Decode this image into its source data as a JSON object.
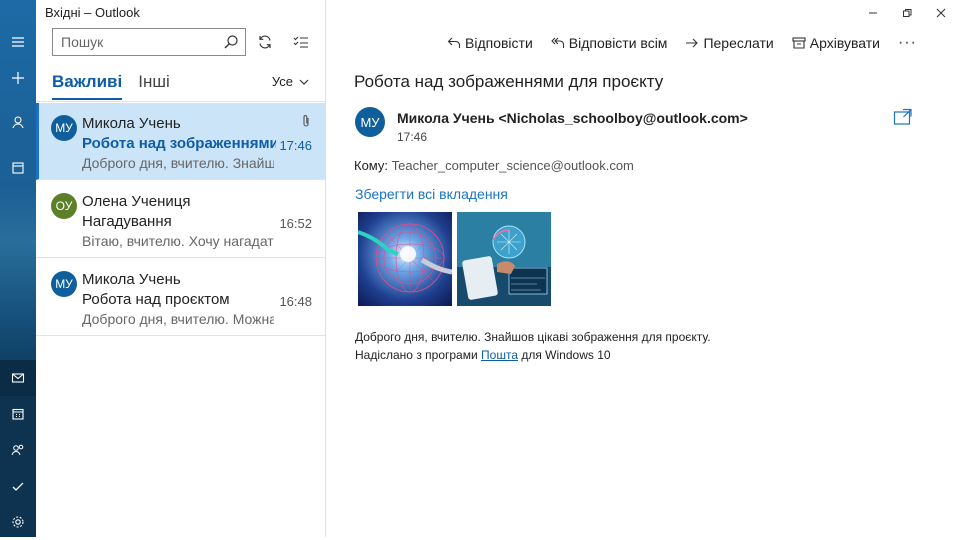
{
  "window": {
    "title": "Вхідні – Outlook"
  },
  "search": {
    "placeholder": "Пошук"
  },
  "tabs": [
    {
      "label": "Важливі"
    },
    {
      "label": "Інші"
    }
  ],
  "filter": {
    "label": "Усе"
  },
  "messages": [
    {
      "avatar_initials": "МУ",
      "avatar_color": "#0f5f9c",
      "from": "Микола Учень",
      "subject": "Робота над зображеннями для проєкту",
      "preview": "Доброго дня, вчителю. Знайшов цікаві зображення для проєкту.",
      "time": "17:46",
      "has_attachment": true,
      "selected": true
    },
    {
      "avatar_initials": "ОУ",
      "avatar_color": "#5c7f28",
      "from": "Олена Учениця",
      "subject": "Нагадування",
      "preview": "Вітаю, вчителю. Хочу нагадати",
      "time": "16:52",
      "has_attachment": false,
      "selected": false
    },
    {
      "avatar_initials": "МУ",
      "avatar_color": "#0f5f9c",
      "from": "Микола Учень",
      "subject": "Робота над проєктом",
      "preview": "Доброго дня, вчителю. Можна",
      "time": "16:48",
      "has_attachment": false,
      "selected": false
    }
  ],
  "toolbar": {
    "reply": "Відповісти",
    "reply_all": "Відповісти всім",
    "forward": "Переслати",
    "archive": "Архівувати",
    "more": "···"
  },
  "reading": {
    "subject": "Робота над зображеннями для проєкту",
    "sender_initials": "МУ",
    "sender": "Микола Учень <Nicholas_schoolboy@outlook.com>",
    "time": "17:46",
    "to_label": "Кому:",
    "to": "Teacher_computer_science@outlook.com",
    "save_all": "Зберегти всі вкладення",
    "body_line1": "Доброго дня, вчителю. Знайшов цікаві зображення для проєкту.",
    "body_line2_prefix": "Надіслано з програми",
    "body_link": "Пошта",
    "body_line2_suffix": "для Windows 10"
  },
  "colors": {
    "accent": "#0f5da8",
    "selected_bg": "#cce4f7",
    "rail": "#1b5f95"
  }
}
